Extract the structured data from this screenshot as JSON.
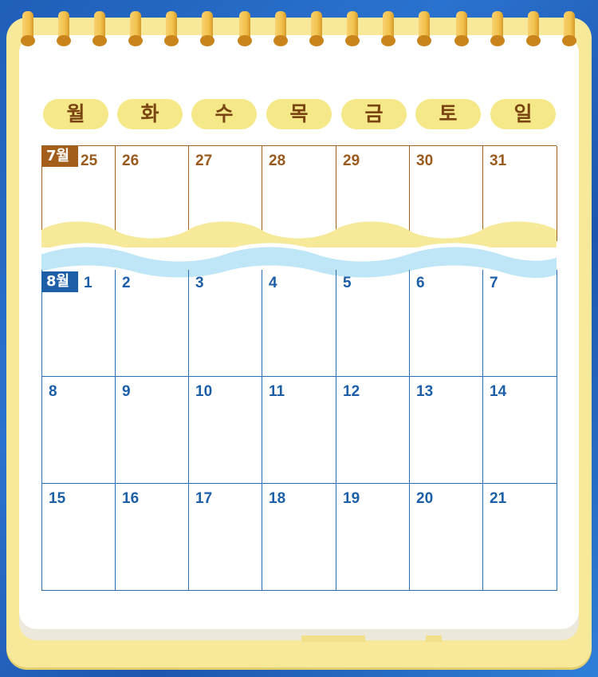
{
  "weekdays": [
    "월",
    "화",
    "수",
    "목",
    "금",
    "토",
    "일"
  ],
  "july": {
    "label": "7월",
    "days": [
      "25",
      "26",
      "27",
      "28",
      "29",
      "30",
      "31"
    ]
  },
  "august": {
    "label": "8월",
    "weeks": [
      [
        "1",
        "2",
        "3",
        "4",
        "5",
        "6",
        "7"
      ],
      [
        "8",
        "9",
        "10",
        "11",
        "12",
        "13",
        "14"
      ],
      [
        "15",
        "16",
        "17",
        "18",
        "19",
        "20",
        "21"
      ]
    ]
  },
  "colors": {
    "background": "#2a72cf",
    "board": "#f8e99a",
    "july_accent": "#a45e1b",
    "august_accent": "#1c5fa8",
    "wave_yellow": "#f6e99a",
    "wave_blue": "#bfe6f7"
  },
  "icons": [
    "spiral-ring-icon"
  ]
}
